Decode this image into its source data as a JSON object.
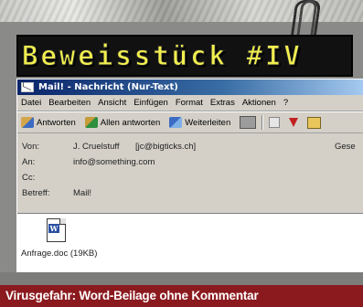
{
  "banner": {
    "title": "Beweisstück #IV"
  },
  "window": {
    "title": "Mail! - Nachricht (Nur-Text)",
    "menu": [
      "Datei",
      "Bearbeiten",
      "Ansicht",
      "Einfügen",
      "Format",
      "Extras",
      "Aktionen",
      "?"
    ],
    "toolbar": {
      "reply": "Antworten",
      "reply_all": "Allen antworten",
      "forward": "Weiterleiten"
    },
    "headers": {
      "from_label": "Von:",
      "from_name": "J. Cruelstuff",
      "from_email": "[jc@bigticks.ch]",
      "sent_label": "Gese",
      "to_label": "An:",
      "to_value": "info@something.com",
      "cc_label": "Cc:",
      "cc_value": "",
      "subject_label": "Betreff:",
      "subject_value": "Mail!"
    },
    "attachment": {
      "icon": "word-document-icon",
      "label": "Anfrage.doc (19KB)"
    }
  },
  "caption": "Virusgefahr: Word-Beilage ohne Kommentar"
}
